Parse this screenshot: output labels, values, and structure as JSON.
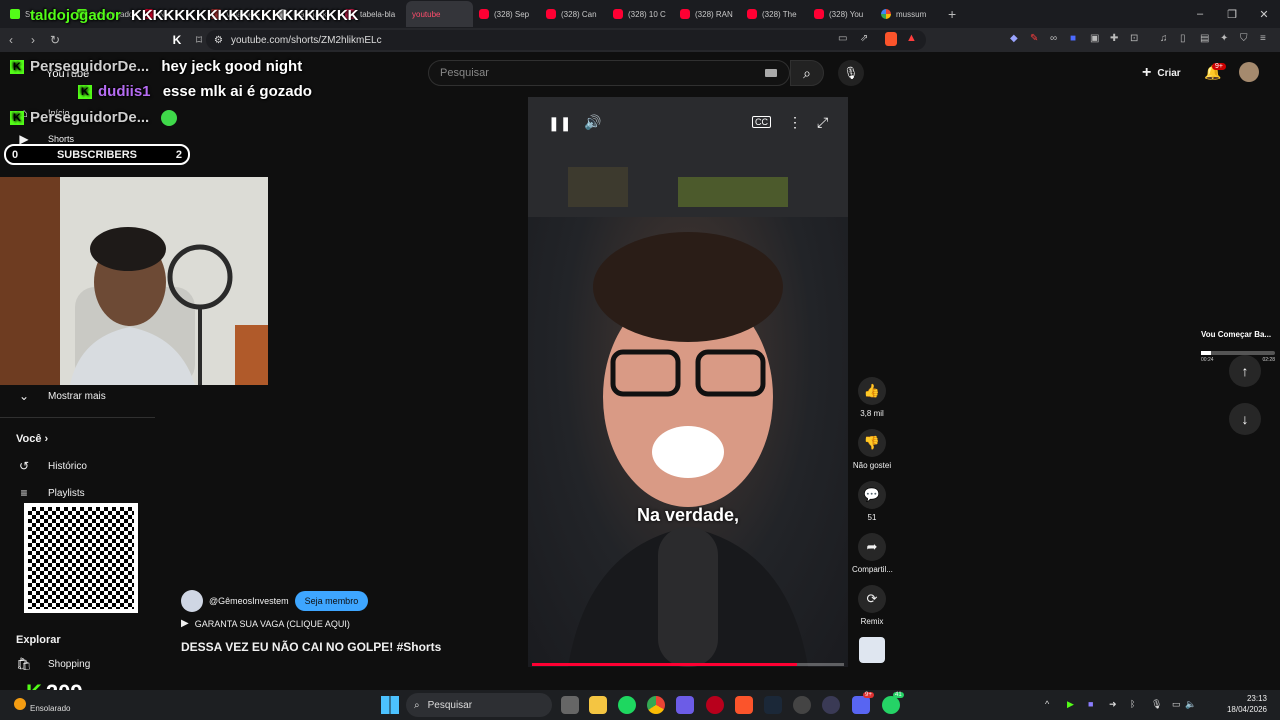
{
  "browser": {
    "tabs": [
      {
        "label": "Stre",
        "favicon": "kick"
      },
      {
        "label": "taldojogador",
        "favicon": "kick"
      },
      {
        "label": "NU",
        "favicon": "youtube"
      },
      {
        "label": "Volante F",
        "favicon": "volante"
      },
      {
        "label": "Blackjack",
        "favicon": "blackjack"
      },
      {
        "label": "tabela-bla",
        "favicon": "mail"
      },
      {
        "label": "youtube",
        "favicon": "youtube",
        "active": true
      },
      {
        "label": "(328) Sep",
        "favicon": "youtube"
      },
      {
        "label": "(328) Can",
        "favicon": "youtube"
      },
      {
        "label": "(328) 10 C",
        "favicon": "youtube"
      },
      {
        "label": "(328) RAN",
        "favicon": "youtube"
      },
      {
        "label": "(328) The",
        "favicon": "youtube"
      },
      {
        "label": "(328) You",
        "favicon": "youtube"
      },
      {
        "label": "mussum",
        "favicon": "google"
      }
    ],
    "new_tab_icon": "plus-icon",
    "url": "youtube.com/shorts/ZM2hlikmELc"
  },
  "overlay": {
    "chat": [
      {
        "user": "PerseguidorDe...",
        "message": "hey jeck good night"
      },
      {
        "user": "dudiis1",
        "message": "esse mlk ai é gozado"
      },
      {
        "user": "PerseguidorDe...",
        "message": ""
      }
    ],
    "top_username": "taldojogador",
    "top_spam": "KKKKKKKKKKKKKKKKKKKKK",
    "subs": {
      "left": "0",
      "label": "SUBSCRIBERS",
      "right": "2"
    },
    "viewer_count": "209",
    "accent": "#53fc18"
  },
  "sidebar": {
    "logo_text": "YouTube",
    "items_top": [
      {
        "label": "Início",
        "icon": "home-icon"
      },
      {
        "label": "Shorts",
        "icon": "shorts-icon"
      }
    ],
    "show_more": "Mostrar mais",
    "you_section": {
      "header": "Você",
      "items": [
        {
          "label": "Histórico",
          "icon": "history-icon"
        },
        {
          "label": "Playlists",
          "icon": "playlist-icon"
        }
      ]
    },
    "explore_section": {
      "header": "Explorar",
      "items": [
        {
          "label": "Shopping",
          "icon": "shopping-icon"
        }
      ]
    }
  },
  "header": {
    "search_placeholder": "Pesquisar",
    "create_label": "Criar",
    "notification_badge": "9+"
  },
  "short": {
    "caption": "Na verdade,",
    "progress": 0.85,
    "channel": "@GêmeosInvestem",
    "member_label": "Seja membro",
    "cta": "GARANTA SUA VAGA (CLIQUE AQUI)",
    "title": "DESSA VEZ EU NÃO CAI NO GOLPE! #Shorts",
    "actions": [
      {
        "name": "like",
        "label": "3,8 mil",
        "icon": "thumbs-up-icon"
      },
      {
        "name": "dislike",
        "label": "Não gostei",
        "icon": "thumbs-down-icon"
      },
      {
        "name": "comments",
        "label": "51",
        "icon": "comment-icon"
      },
      {
        "name": "share",
        "label": "Compartil...",
        "icon": "share-icon"
      },
      {
        "name": "remix",
        "label": "Remix",
        "icon": "remix-icon"
      }
    ]
  },
  "next_video": {
    "title": "Vou Começar Ba...",
    "left_time": "00:24",
    "right_time": "02:28",
    "progress": 0.14
  },
  "taskbar": {
    "weather": "Ensolarado",
    "search_placeholder": "Pesquisar",
    "time": "23:13",
    "date": "18/04/2026",
    "discord_badge": "9+",
    "whatsapp_badge": "41"
  }
}
